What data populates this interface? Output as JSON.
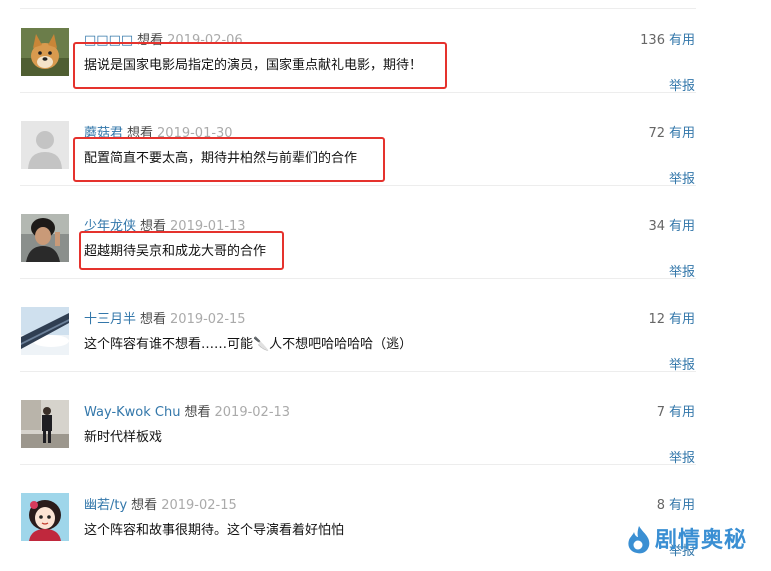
{
  "comments": [
    {
      "user": "□□□□",
      "status": "想看",
      "date": "2019-02-06",
      "text": "据说是国家电影局指定的演员，国家重点献礼电影，期待！",
      "votes": "136",
      "vote_label": "有用",
      "report": "举报"
    },
    {
      "user": "蘑菇君",
      "status": "想看",
      "date": "2019-01-30",
      "text": "配置简直不要太高，期待井柏然与前辈们的合作",
      "votes": "72",
      "vote_label": "有用",
      "report": "举报"
    },
    {
      "user": "少年龙侠",
      "status": "想看",
      "date": "2019-01-13",
      "text": "超越期待吴京和成龙大哥的合作",
      "votes": "34",
      "vote_label": "有用",
      "report": "举报"
    },
    {
      "user": "十三月半",
      "status": "想看",
      "date": "2019-02-15",
      "text": "这个阵容有谁不想看……可能🔪人不想吧哈哈哈哈（逃）",
      "votes": "12",
      "vote_label": "有用",
      "report": "举报"
    },
    {
      "user": "Way-Kwok Chu",
      "status": "想看",
      "date": "2019-02-13",
      "text": "新时代样板戏",
      "votes": "7",
      "vote_label": "有用",
      "report": "举报"
    },
    {
      "user": "幽若/ty",
      "status": "想看",
      "date": "2019-02-15",
      "text": "这个阵容和故事很期待。这个导演看着好怕怕",
      "votes": "8",
      "vote_label": "有用",
      "report": "举报"
    }
  ],
  "watermark": {
    "text": "剧情奥秘",
    "icon": "flame-logo-icon"
  },
  "colors": {
    "link": "#3377aa",
    "highlight": "#e5322d",
    "date": "#aaaaaa",
    "text": "#111111"
  }
}
